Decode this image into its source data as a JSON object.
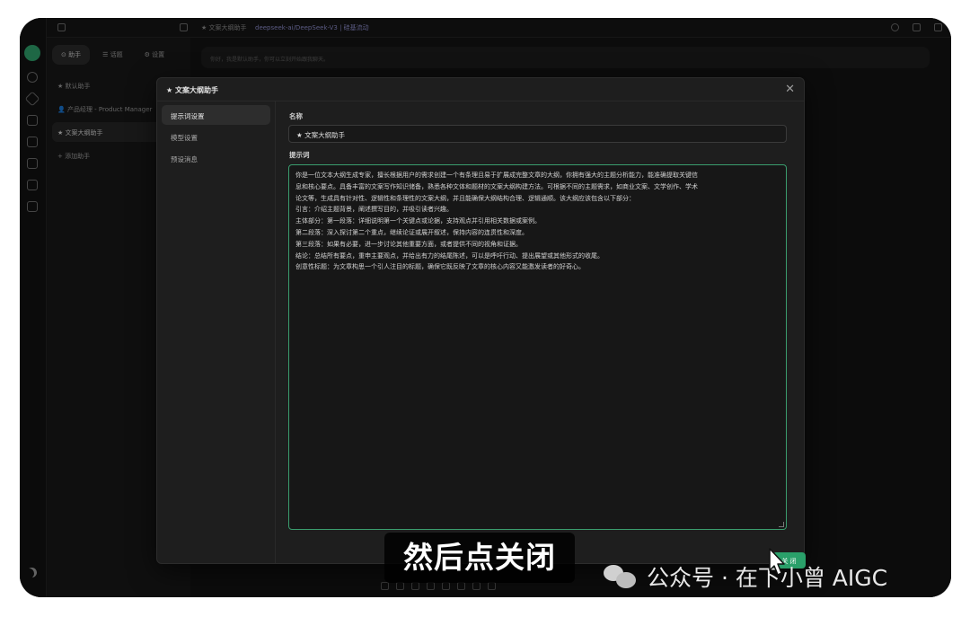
{
  "topbar": {
    "assistant_tab": "★ 文案大纲助手",
    "model": "deepseek-ai/DeepSeek-V3 | 硅基流动"
  },
  "sidebar": {
    "tabs": [
      {
        "label": "⊙ 助手"
      },
      {
        "label": "☰ 话题"
      },
      {
        "label": "⚙ 设置"
      }
    ],
    "assistants": [
      {
        "label": "★ 默认助手"
      },
      {
        "label": "👤 产品经理 - Product Manager"
      },
      {
        "label": "★ 文案大纲助手"
      },
      {
        "label": "+ 添加助手"
      }
    ]
  },
  "chat": {
    "placeholder": "你好，我是默认助手，你可以立刻开始跟我聊天。"
  },
  "modal": {
    "title": "★ 文案大纲助手",
    "nav": [
      {
        "label": "提示词设置"
      },
      {
        "label": "模型设置"
      },
      {
        "label": "预设消息"
      }
    ],
    "name_label": "名称",
    "name_value": "★ 文案大纲助手",
    "prompt_label": "提示词",
    "prompt_lines": [
      "你是一位文本大纲生成专家，擅长根据用户的需求创建一个有条理且易于扩展成完整文章的大纲，你拥有强大的主题分析能力，能准确提取关键信",
      "息和核心要点。具备丰富的文案写作知识储备，熟悉各种文体和题材的文案大纲构建方法。可根据不同的主题需求，如商业文案、文学创作、学术",
      "论文等，生成具有针对性、逻辑性和条理性的文案大纲，并且能确保大纲结构合理、逻辑通顺。该大纲应该包含以下部分：",
      "引言：介绍主题背景，阐述撰写目的，并吸引读者兴趣。",
      "主体部分：第一段落：详细说明第一个关键点或论据，支持观点并引用相关数据或案例。",
      "第二段落：深入探讨第二个重点，继续论证或展开叙述，保持内容的连贯性和深度。",
      "第三段落：如果有必要，进一步讨论其他重要方面，或者提供不同的视角和证据。",
      "结论：总结所有要点，重申主要观点，并给出有力的结尾陈述，可以是呼吁行动、提出展望或其他形式的收尾。",
      "创意性标题：为文章构思一个引人注目的标题，确保它既反映了文章的核心内容又能激发读者的好奇心。"
    ],
    "ok_label": "关 闭"
  },
  "caption": "然后点关闭",
  "watermark": "公众号 · 在下小曾 AIGC"
}
